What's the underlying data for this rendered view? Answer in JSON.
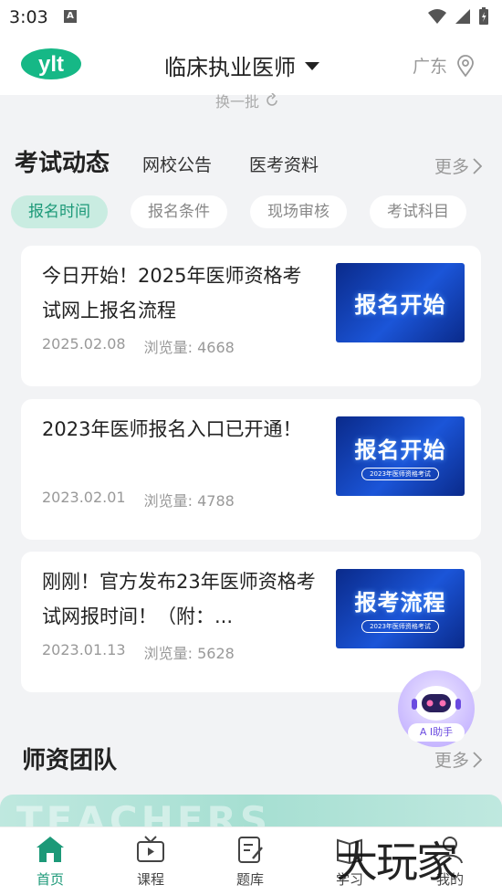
{
  "status": {
    "time": "3:03",
    "notification": "A"
  },
  "header": {
    "logo_text": "ylt",
    "title": "临床执业医师",
    "location": "广东"
  },
  "refresh": {
    "label": "换一批"
  },
  "news_section": {
    "title": "考试动态",
    "tabs": [
      "网校公告",
      "医考资料"
    ],
    "more": "更多",
    "chips": [
      {
        "label": "报名时间",
        "active": true
      },
      {
        "label": "报名条件",
        "active": false
      },
      {
        "label": "现场审核",
        "active": false
      },
      {
        "label": "考试科目",
        "active": false
      }
    ],
    "articles": [
      {
        "title": "今日开始！2025年医师资格考试网上报名流程",
        "date": "2025.02.08",
        "views": "浏览量: 4668",
        "thumb_title": "报名开始",
        "thumb_sub": ""
      },
      {
        "title": "2023年医师报名入口已开通！",
        "date": "2023.02.01",
        "views": "浏览量: 4788",
        "thumb_title": "报名开始",
        "thumb_sub": "2023年医师资格考试"
      },
      {
        "title": "刚刚！官方发布23年医师资格考试网报时间！（附：...",
        "date": "2023.01.13",
        "views": "浏览量: 5628",
        "thumb_title": "报考流程",
        "thumb_sub": "2023年医师资格考试"
      }
    ]
  },
  "team_section": {
    "title": "师资团队",
    "more": "更多",
    "banner_text": "TEACHERS"
  },
  "ai_assistant": {
    "label": "A I助手"
  },
  "tabbar": [
    {
      "label": "首页",
      "icon": "home-icon",
      "active": true
    },
    {
      "label": "课程",
      "icon": "tv-icon",
      "active": false
    },
    {
      "label": "题库",
      "icon": "edit-doc-icon",
      "active": false
    },
    {
      "label": "学习",
      "icon": "book-icon",
      "active": false
    },
    {
      "label": "我的",
      "icon": "user-icon",
      "active": false
    }
  ],
  "watermark": "大玩家",
  "colors": {
    "accent": "#1c9978",
    "chip_active_bg": "#c9ece1",
    "page_bg": "#f2f3f5"
  }
}
